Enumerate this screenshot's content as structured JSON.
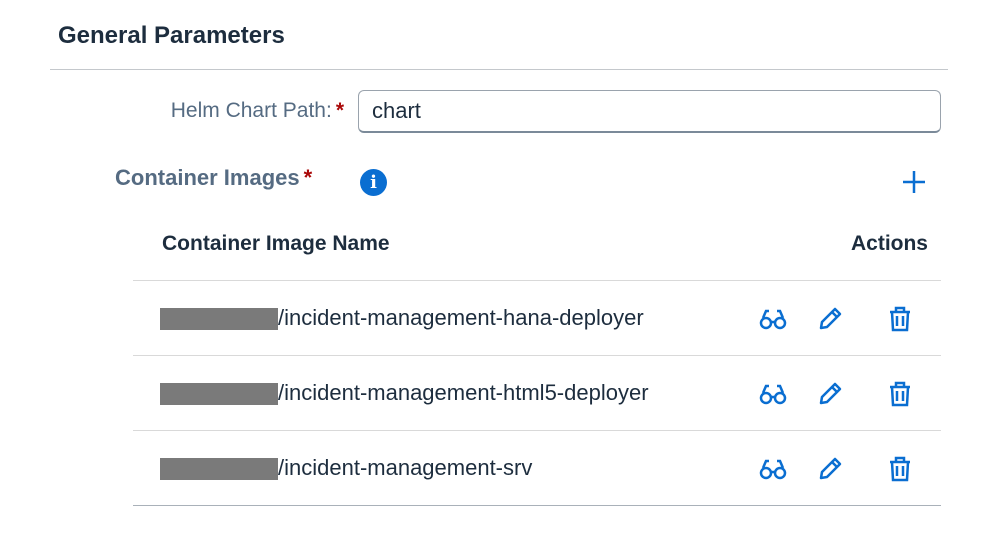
{
  "section_title": "General Parameters",
  "helm": {
    "label": "Helm Chart Path:",
    "required": "*",
    "value": "chart"
  },
  "container_images": {
    "label": "Container Images",
    "required": "*",
    "info_icon": "i",
    "columns": {
      "name": "Container Image Name",
      "actions": "Actions"
    },
    "rows": [
      {
        "name": "/incident-management-hana-deployer"
      },
      {
        "name": "/incident-management-html5-deployer"
      },
      {
        "name": "/incident-management-srv"
      }
    ]
  },
  "colors": {
    "accent": "#0a6ed1",
    "required": "#aa0808"
  }
}
